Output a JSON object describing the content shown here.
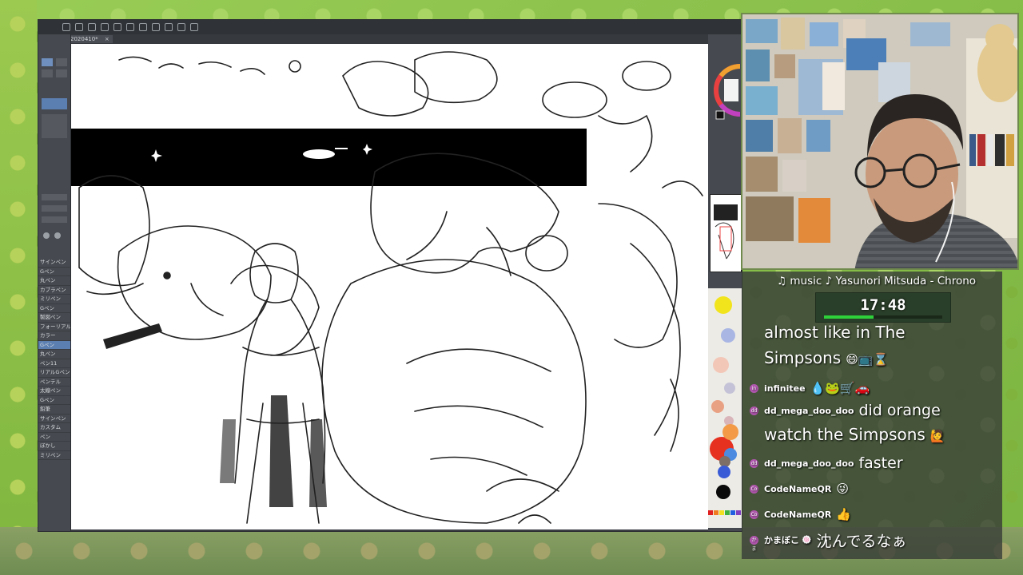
{
  "app": {
    "document_tab": "2020410*",
    "tab_close": "×",
    "brushes": [
      "サインペン",
      "Gペン",
      "丸ペン",
      "カブラペン",
      "ミリペン",
      "Gペン",
      "製図ペン",
      "フォーリアル",
      "カラー",
      "Gペン",
      "丸ペン",
      "ペン11",
      "リアルGペン",
      "ペンテル",
      "太線ペン",
      "Gペン",
      "鉛筆",
      "サインペン",
      "カスタム",
      "ペン",
      "ぼかし",
      "ミリペン"
    ],
    "active_brush_index": 9,
    "palette_colors": [
      "#f2e41c",
      "#a9b6e4",
      "#f3c7b8",
      "#c4c2d6",
      "#e9a184",
      "#d9b5ba",
      "#e63020",
      "#f29a46",
      "#4d8be0",
      "#7d6f66",
      "#3a5bd6",
      "#0a0a0a"
    ],
    "color_strip": [
      "#e02020",
      "#f07a20",
      "#f0e020",
      "#40b040",
      "#2060e0",
      "#8040c0"
    ]
  },
  "music": "♫ music ♪ Yasunori Mitsuda - Chrono",
  "timer": {
    "label": "17:48",
    "progress": 0.42
  },
  "chat": [
    {
      "type": "text",
      "text": "almost like in The"
    },
    {
      "type": "text",
      "text": "Simpsons",
      "emoji": "😄📺⌛"
    },
    {
      "type": "user",
      "avatar": "in",
      "user": "infinitee",
      "message": "",
      "emoji": "💧🐸🛒🚗"
    },
    {
      "type": "user",
      "avatar": "dd",
      "user": "dd_mega_doo_doo",
      "message": "did orange"
    },
    {
      "type": "text",
      "text": "watch the Simpsons",
      "emoji": "🙋"
    },
    {
      "type": "user",
      "avatar": "dd",
      "user": "dd_mega_doo_doo",
      "message": "faster"
    },
    {
      "type": "user",
      "avatar": "Co",
      "user": "CodeNameQR",
      "message": "",
      "emoji": "😜"
    },
    {
      "type": "user",
      "avatar": "Co",
      "user": "CodeNameQR",
      "message": "",
      "emoji": "👍"
    },
    {
      "type": "user",
      "avatar": "かま",
      "user": "かまぼこ",
      "message": "沈んでるなぁ",
      "emoji": "🍥"
    }
  ]
}
